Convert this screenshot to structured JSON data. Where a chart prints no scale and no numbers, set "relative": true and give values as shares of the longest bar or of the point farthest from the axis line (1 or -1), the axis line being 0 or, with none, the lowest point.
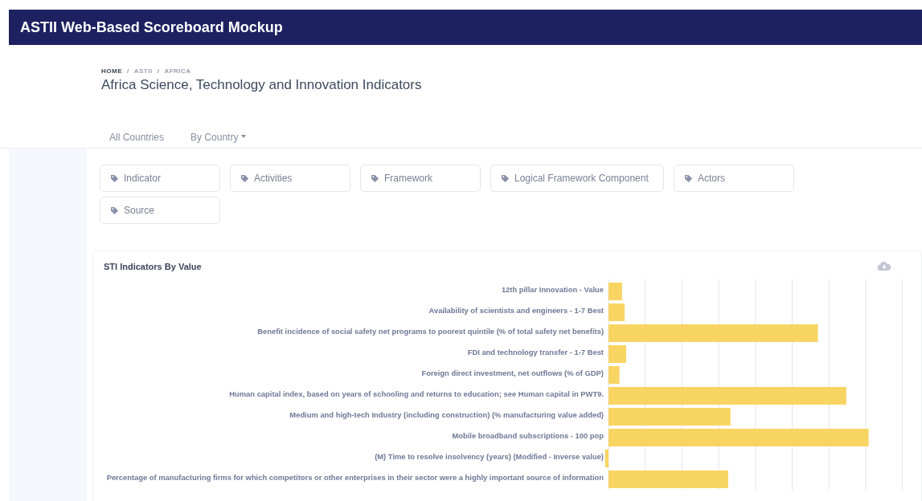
{
  "header": {
    "title": "ASTII Web-Based Scoreboard Mockup"
  },
  "breadcrumb": [
    {
      "label": "HOME",
      "selected": true
    },
    {
      "label": "ASTII",
      "selected": false
    },
    {
      "label": "AFRICA",
      "selected": false
    }
  ],
  "breadcrumb_separator": "/",
  "page_title": "Africa Science, Technology and Innovation Indicators",
  "nav": [
    {
      "label": "All Countries",
      "kind": "link"
    },
    {
      "label": "By Country",
      "kind": "dropdown"
    }
  ],
  "filters": [
    "Indicator",
    "Activities",
    "Framework",
    "Logical Framework Component",
    "Actors",
    "Source"
  ],
  "chart_card": {
    "title": "STI Indicators By Value",
    "chart_data": {
      "type": "bar",
      "orientation": "horizontal",
      "relative": true,
      "categories": [
        "12th pillar Innovation - Value",
        "Availability of scientists and engineers - 1-7 Best",
        "Benefit incidence of social safety net programs to poorest quintile (% of total safety net benefits)",
        "FDI and technology transfer - 1-7 Best",
        "Foreign direct investment, net outflows (% of GDP)",
        "Human capital index, based on years of schooling and returns to education; see Human capital in PWT9.",
        "Medium and high-tech Industry (including construction) (% manufacturing value added)",
        "Mobile broadband subscriptions - 100 pop",
        "(M) Time to resolve insolvency (years) (Modified - Inverse value)",
        "Percentage of manufacturing firms for which competitors or other enterprises in their sector were a highly important source of information"
      ],
      "series": [
        {
          "color": "#f8d462",
          "values": [
            0.052,
            0.062,
            0.805,
            0.068,
            0.042,
            0.914,
            0.469,
            1,
            -0.013,
            0.46
          ]
        }
      ]
    }
  }
}
